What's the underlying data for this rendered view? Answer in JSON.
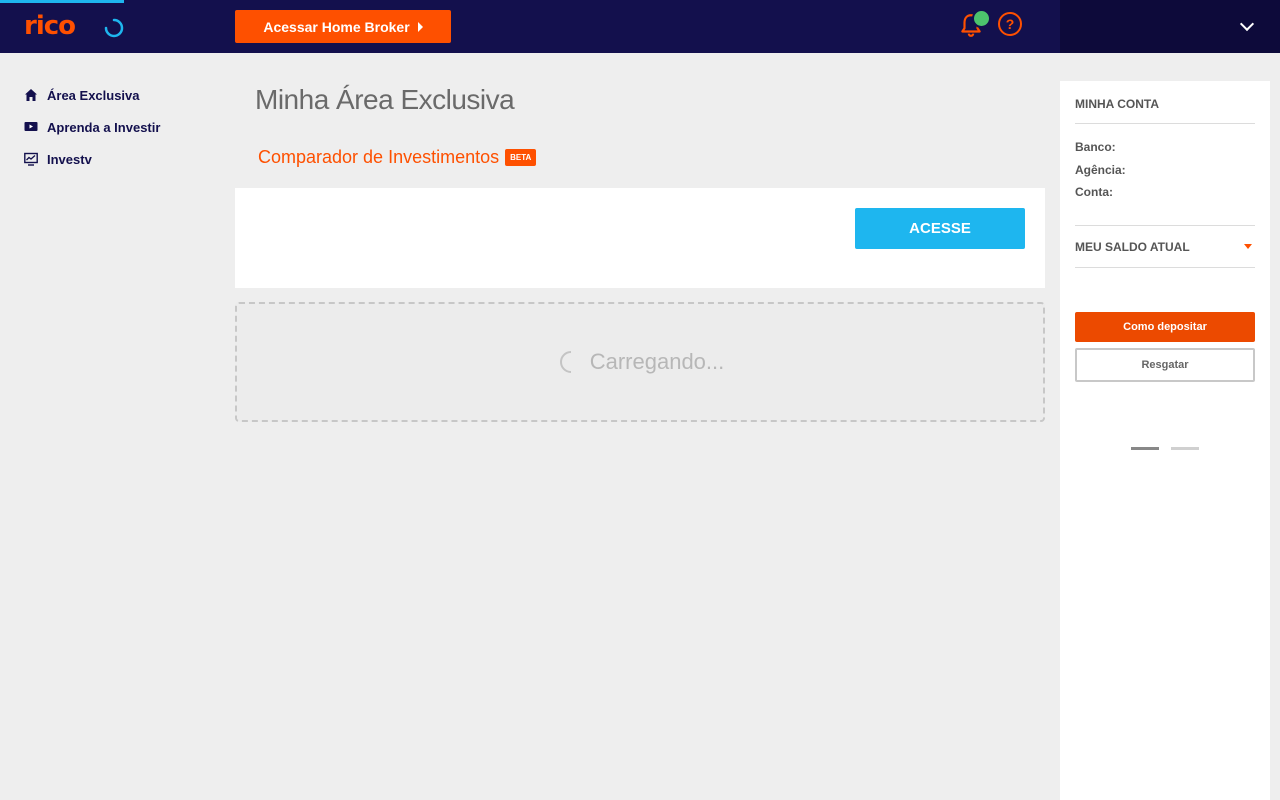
{
  "header": {
    "logo_text": "rico",
    "home_broker_label": "Acessar Home Broker",
    "help_label": "?"
  },
  "sidebar": {
    "items": [
      {
        "label": "Área Exclusiva",
        "icon": "home-icon"
      },
      {
        "label": "Aprenda a Investir",
        "icon": "video-play-icon"
      },
      {
        "label": "Investv",
        "icon": "chart-monitor-icon"
      }
    ]
  },
  "main": {
    "title": "Minha Área Exclusiva",
    "comparador_label": "Comparador de Investimentos",
    "beta_badge": "BETA",
    "acesse_label": "ACESSE",
    "loading_text": "Carregando..."
  },
  "account": {
    "title": "MINHA CONTA",
    "banco_label": "Banco:",
    "agencia_label": "Agência:",
    "conta_label": "Conta:",
    "saldo_label": "MEU SALDO ATUAL",
    "depositar_label": "Como depositar",
    "resgatar_label": "Resgatar"
  },
  "colors": {
    "navy": "#13104d",
    "orange": "#fe5000",
    "cyan": "#1eb6ef",
    "green": "#4cc36d",
    "background": "#eeeeee"
  }
}
